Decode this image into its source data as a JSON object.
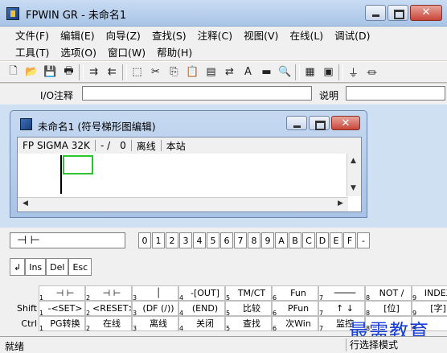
{
  "app": {
    "title": "FPWIN GR - 未命名1"
  },
  "menus": {
    "row1": [
      "文件(F)",
      "编辑(E)",
      "向导(Z)",
      "查找(S)",
      "注释(C)",
      "视图(V)",
      "在线(L)",
      "调试(D)"
    ],
    "row2": [
      "工具(T)",
      "选项(O)",
      "窗口(W)",
      "帮助(H)"
    ]
  },
  "toolbar": {
    "icons": [
      "new-file-icon",
      "open-folder-icon",
      "save-icon",
      "print-icon",
      "sep",
      "step-icon",
      "step-back-icon",
      "sep",
      "select-icon",
      "cut-icon",
      "copy-icon",
      "paste-icon",
      "block-icon",
      "convert-icon",
      "text-icon",
      "bar-icon",
      "binoculars-icon",
      "sep",
      "monitor-icon",
      "chart-icon",
      "sep",
      "io-icon",
      "output-icon"
    ],
    "glyphs": [
      "🗋",
      "📂",
      "💾",
      "🖶",
      "",
      "⇉",
      "⇇",
      "",
      "⬚",
      "✂",
      "⎘",
      "📋",
      "▤",
      "⇄",
      "A",
      "▬",
      "🔍",
      "",
      "▦",
      "▣",
      "",
      "⏚",
      "⏛"
    ]
  },
  "io_line": {
    "io_label": "I/O注释",
    "note_label": "说明"
  },
  "child": {
    "title": "未命名1 (符号梯形图编辑)",
    "plc": "FP SIGMA 32K",
    "pos": "- /",
    "count": "0",
    "mode": "离线",
    "station": "本站"
  },
  "funcbar": {
    "instruction": "⊣ ⊢",
    "keys": [
      "0",
      "1",
      "2",
      "3",
      "4",
      "5",
      "6",
      "7",
      "8",
      "9",
      "A",
      "B",
      "C",
      "D",
      "E",
      "F",
      "-"
    ],
    "edit_buttons": [
      "↲",
      "Ins",
      "Del",
      "Esc"
    ],
    "rows": [
      {
        "label": "",
        "cells": [
          {
            "num": "1",
            "text": "⊣ ⊢"
          },
          {
            "num": "2",
            "text": "⊣ ⊢"
          },
          {
            "num": "3",
            "text": "│"
          },
          {
            "num": "4",
            "text": "-[OUT]"
          },
          {
            "num": "5",
            "text": "TM/CT"
          },
          {
            "num": "6",
            "text": "Fun"
          },
          {
            "num": "7",
            "text": "────"
          },
          {
            "num": "8",
            "text": "NOT /"
          },
          {
            "num": "9",
            "text": "INDEX"
          }
        ]
      },
      {
        "label": "Shift",
        "cells": [
          {
            "num": "1",
            "text": "-<SET>"
          },
          {
            "num": "2",
            "text": "<RESET>"
          },
          {
            "num": "3",
            "text": "(DF (/))"
          },
          {
            "num": "4",
            "text": "(END)"
          },
          {
            "num": "5",
            "text": "比较"
          },
          {
            "num": "6",
            "text": "PFun"
          },
          {
            "num": "7",
            "text": "↑ ↓"
          },
          {
            "num": "8",
            "text": "[位]"
          },
          {
            "num": "9",
            "text": "[字]"
          }
        ]
      },
      {
        "label": "Ctrl",
        "cells": [
          {
            "num": "1",
            "text": "PG转换"
          },
          {
            "num": "2",
            "text": "在线"
          },
          {
            "num": "3",
            "text": "离线"
          },
          {
            "num": "4",
            "text": "关闭"
          },
          {
            "num": "5",
            "text": "查找"
          },
          {
            "num": "6",
            "text": "次Win"
          },
          {
            "num": "7",
            "text": "监控"
          },
          {
            "num": "8",
            "text": ""
          },
          {
            "num": "9",
            "text": ""
          }
        ]
      }
    ]
  },
  "statusbar": {
    "left": "就绪",
    "right": "行选择模式"
  },
  "watermark": "最需教育"
}
